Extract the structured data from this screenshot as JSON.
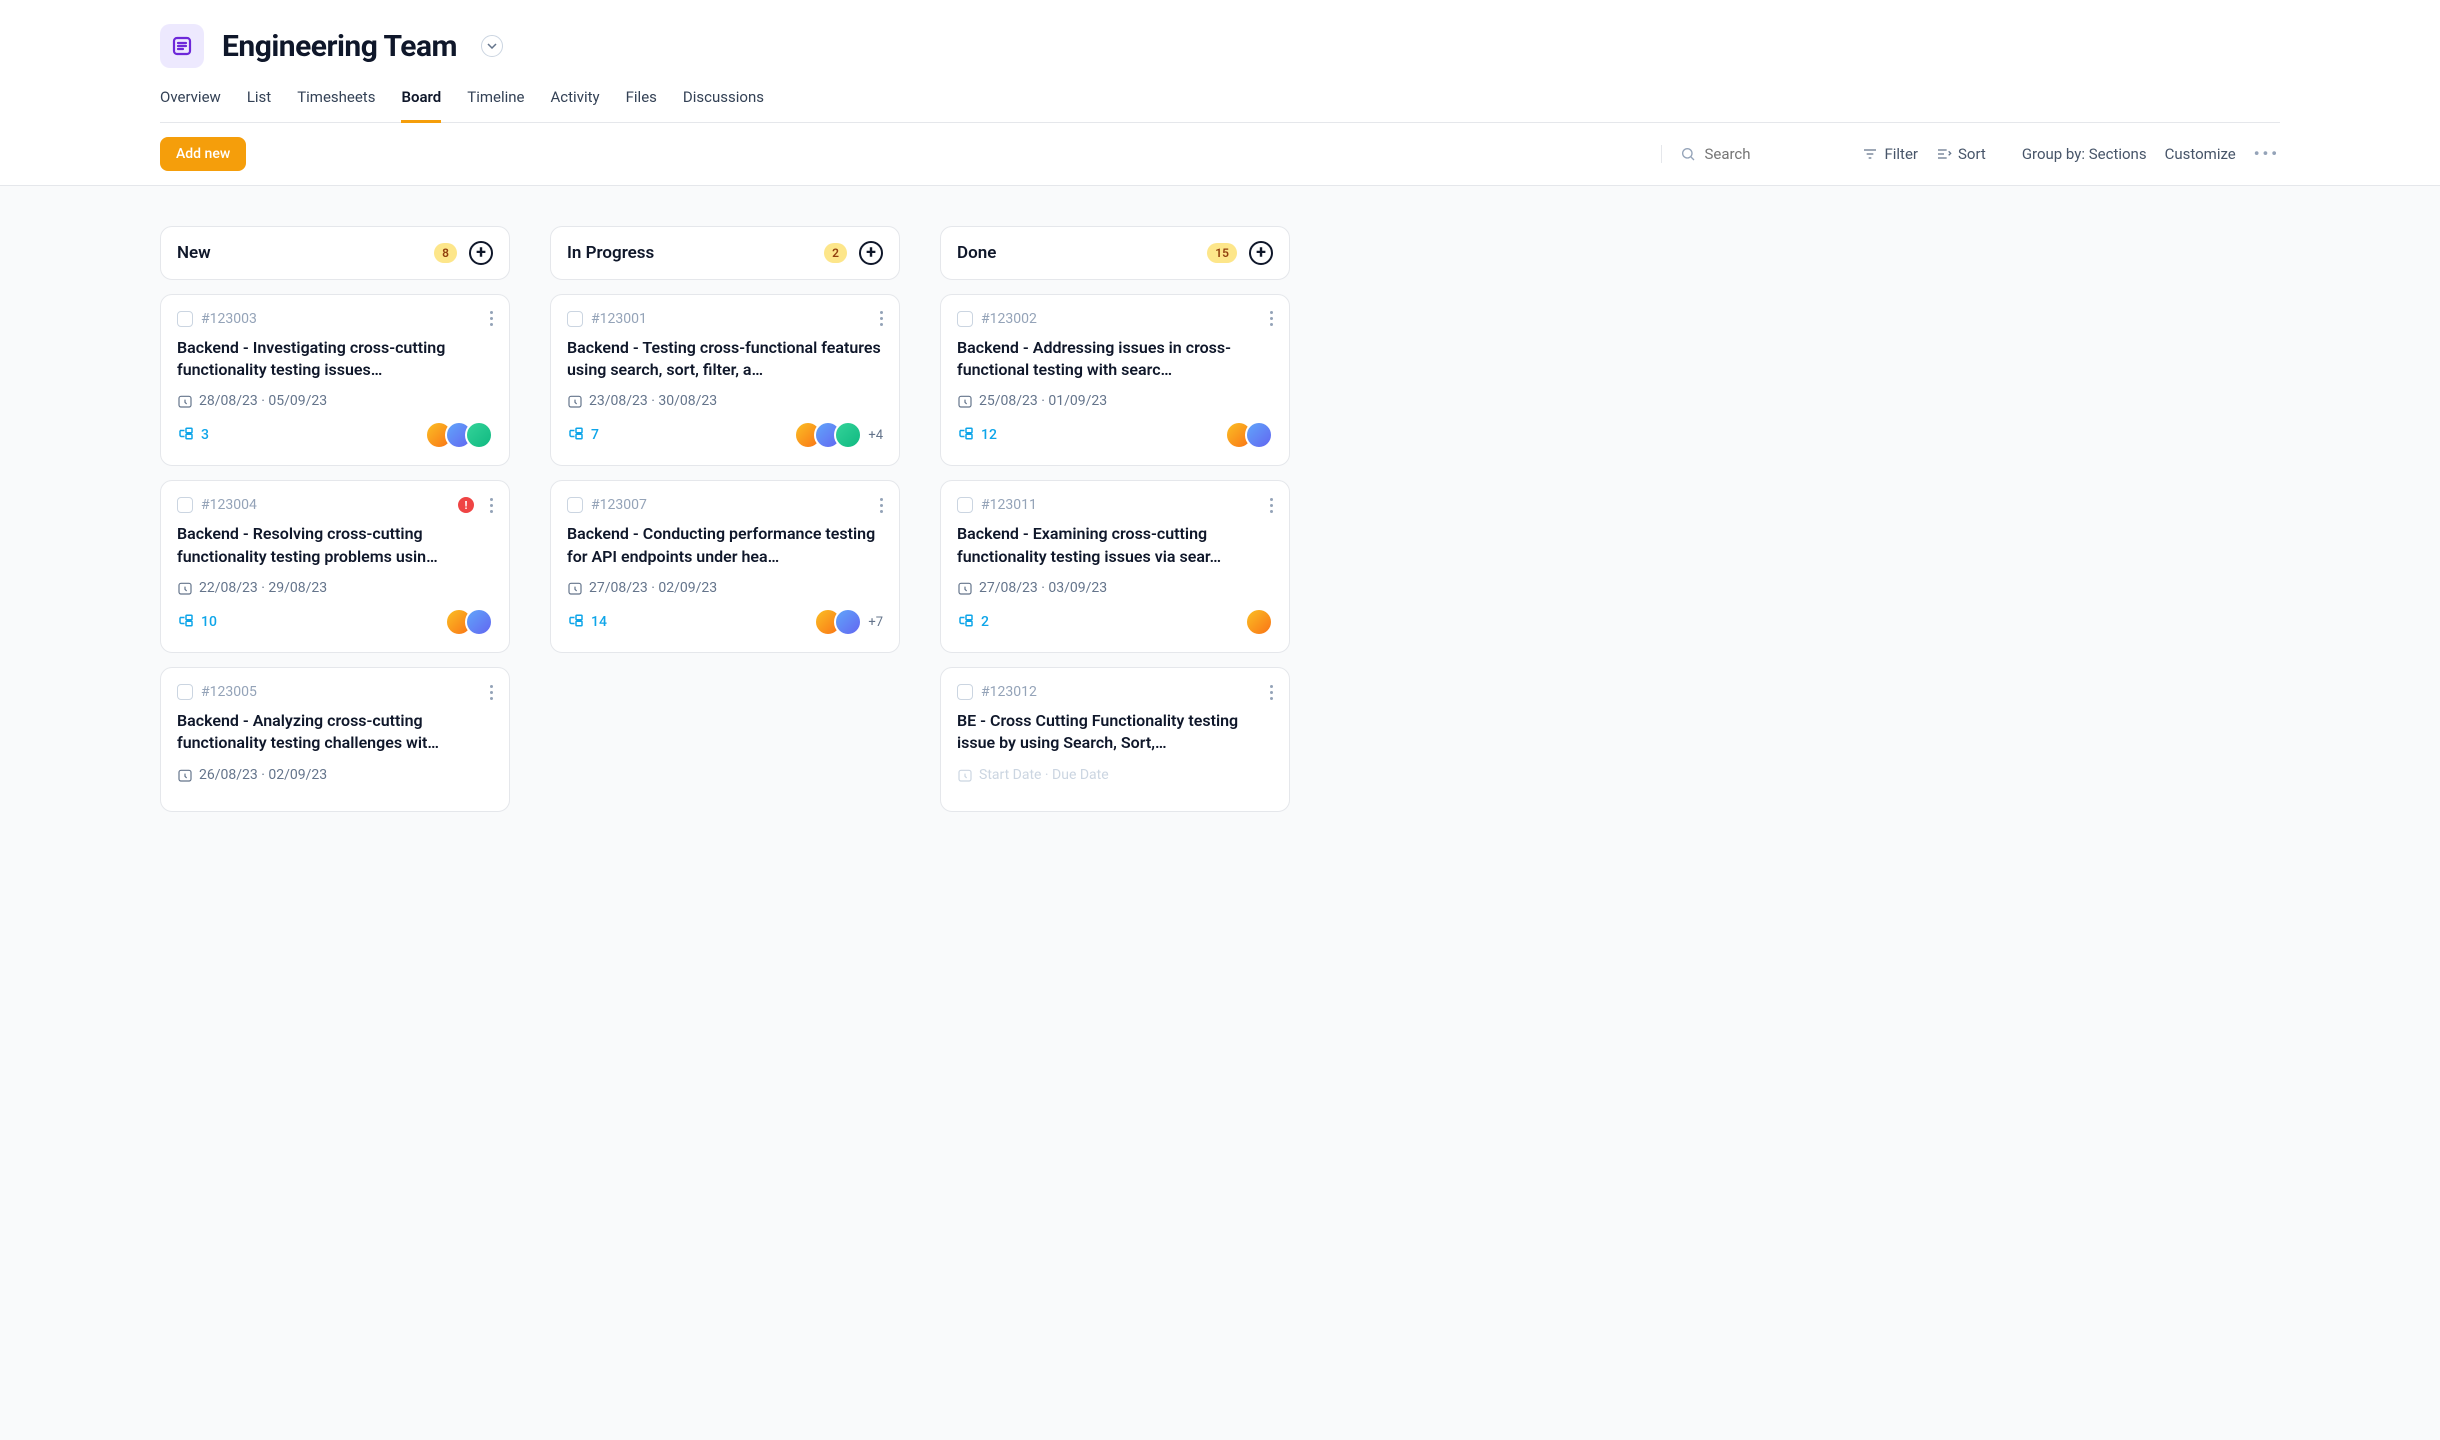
{
  "header": {
    "title": "Engineering Team"
  },
  "tabs": [
    "Overview",
    "List",
    "Timesheets",
    "Board",
    "Timeline",
    "Activity",
    "Files",
    "Discussions"
  ],
  "activeTab": "Board",
  "toolbar": {
    "add": "Add new",
    "searchPlaceholder": "Search",
    "filter": "Filter",
    "sort": "Sort",
    "group": "Group by: Sections",
    "customize": "Customize"
  },
  "columns": [
    {
      "title": "New",
      "count": 8,
      "cards": [
        {
          "id": "#123003",
          "title": "Backend - Investigating cross-cutting functionality testing issues…",
          "start": "28/08/23",
          "end": "05/09/23",
          "subtasks": 3,
          "avatars": 3,
          "more": "",
          "alert": false
        },
        {
          "id": "#123004",
          "title": "Backend - Resolving cross-cutting functionality testing problems usin…",
          "start": "22/08/23",
          "end": "29/08/23",
          "subtasks": 10,
          "avatars": 2,
          "more": "",
          "alert": true
        },
        {
          "id": "#123005",
          "title": "Backend - Analyzing cross-cutting functionality testing challenges wit…",
          "start": "26/08/23",
          "end": "02/09/23",
          "subtasks": null,
          "avatars": 0,
          "more": "",
          "alert": false
        }
      ]
    },
    {
      "title": "In Progress",
      "count": 2,
      "cards": [
        {
          "id": "#123001",
          "title": "Backend - Testing cross-functional features using search, sort, filter, a…",
          "start": "23/08/23",
          "end": "30/08/23",
          "subtasks": 7,
          "avatars": 3,
          "more": "+4",
          "alert": false
        },
        {
          "id": "#123007",
          "title": "Backend - Conducting performance testing for API endpoints under hea…",
          "start": "27/08/23",
          "end": "02/09/23",
          "subtasks": 14,
          "avatars": 2,
          "more": "+7",
          "alert": false
        }
      ]
    },
    {
      "title": "Done",
      "count": 15,
      "cards": [
        {
          "id": "#123002",
          "title": "Backend - Addressing issues in cross-functional testing with searc…",
          "start": "25/08/23",
          "end": "01/09/23",
          "subtasks": 12,
          "avatars": 2,
          "more": "",
          "alert": false
        },
        {
          "id": "#123011",
          "title": "Backend - Examining cross-cutting functionality testing issues via sear…",
          "start": "27/08/23",
          "end": "03/09/23",
          "subtasks": 2,
          "avatars": 1,
          "more": "",
          "alert": false
        },
        {
          "id": "#123012",
          "title": "BE - Cross Cutting Functionality testing issue by using Search, Sort,…",
          "start": "",
          "end": "",
          "placeholder": "Start Date · Due Date",
          "subtasks": null,
          "avatars": 0,
          "more": "",
          "alert": false
        }
      ]
    }
  ]
}
